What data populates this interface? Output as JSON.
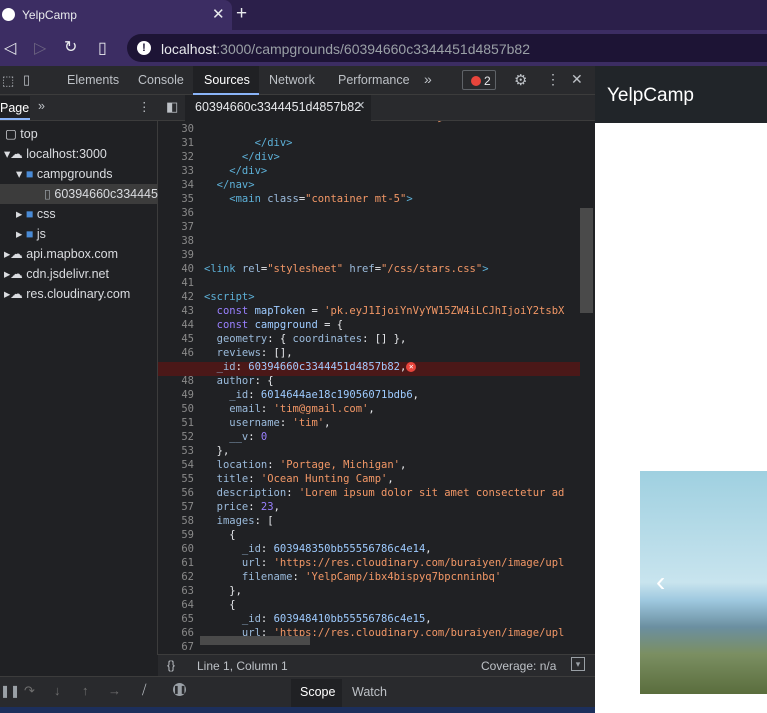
{
  "browser": {
    "tab_title": "YelpCamp",
    "url_host": "localhost",
    "url_rest": ":3000/campgrounds/60394660c3344451d4857b82"
  },
  "devtools": {
    "tabs": [
      "Elements",
      "Console",
      "Sources",
      "Network",
      "Performance"
    ],
    "active_tab": "Sources",
    "error_count": "2",
    "left_panel_tab": "Page",
    "tree": {
      "top": "top",
      "host": "localhost:3000",
      "folder_campgrounds": "campgrounds",
      "file": "60394660c334445",
      "folder_css": "css",
      "folder_js": "js",
      "domain1": "api.mapbox.com",
      "domain2": "cdn.jsdelivr.net",
      "domain3": "res.cloudinary.com"
    },
    "open_file": "60394660c3344451d4857b82",
    "status_position": "Line 1, Column 1",
    "coverage": "Coverage: n/a",
    "bottom_tabs": [
      "Scope",
      "Watch"
    ],
    "active_bottom_tab": "Scope",
    "line_numbers": [
      "30",
      "31",
      "32",
      "33",
      "34",
      "35",
      "36",
      "37",
      "38",
      "39",
      "40",
      "41",
      "42",
      "43",
      "44",
      "45",
      "46",
      "47",
      "48",
      "49",
      "50",
      "51",
      "52",
      "53",
      "54",
      "55",
      "56",
      "57",
      "58",
      "59",
      "60",
      "61",
      "62",
      "63",
      "64",
      "65",
      "66",
      "67"
    ]
  },
  "page_preview": {
    "brand": "YelpCamp"
  }
}
